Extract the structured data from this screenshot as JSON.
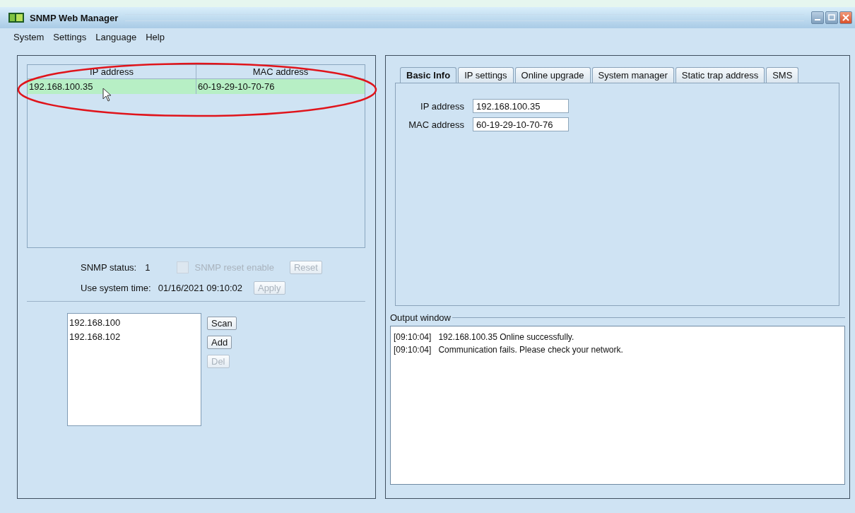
{
  "window": {
    "title": "SNMP Web Manager"
  },
  "menu": [
    "System",
    "Settings",
    "Language",
    "Help"
  ],
  "device_table": {
    "columns": [
      "IP address",
      "MAC address"
    ],
    "rows": [
      {
        "ip": "192.168.100.35",
        "mac": "60-19-29-10-70-76",
        "selected": true
      }
    ]
  },
  "snmp_status": {
    "label": "SNMP status:",
    "value": "1"
  },
  "snmp_reset": {
    "label": "SNMP reset enable",
    "checked": false,
    "disabled": true
  },
  "reset_button": {
    "label": "Reset",
    "disabled": true
  },
  "system_time": {
    "label": "Use system time:",
    "value": "01/16/2021 09:10:02"
  },
  "apply_button": {
    "label": "Apply",
    "disabled": true
  },
  "segments": [
    "192.168.100",
    "192.168.102"
  ],
  "segment_buttons": [
    {
      "label": "Scan",
      "disabled": false
    },
    {
      "label": "Add",
      "disabled": false
    },
    {
      "label": "Del",
      "disabled": true
    }
  ],
  "tabs": [
    {
      "label": "Basic Info",
      "selected": true
    },
    {
      "label": "IP settings",
      "selected": false
    },
    {
      "label": "Online upgrade",
      "selected": false
    },
    {
      "label": "System manager",
      "selected": false
    },
    {
      "label": "Static trap address",
      "selected": false
    },
    {
      "label": "SMS",
      "selected": false
    }
  ],
  "basic_info": [
    {
      "label": "IP address",
      "value": "192.168.100.35"
    },
    {
      "label": "MAC address",
      "value": "60-19-29-10-70-76"
    }
  ],
  "output_window": {
    "title": "Output window",
    "lines": [
      {
        "time": "[09:10:04]",
        "message": "192.168.100.35 Online successfully."
      },
      {
        "time": "[09:10:04]",
        "message": "Communication fails. Please check your network."
      }
    ]
  }
}
